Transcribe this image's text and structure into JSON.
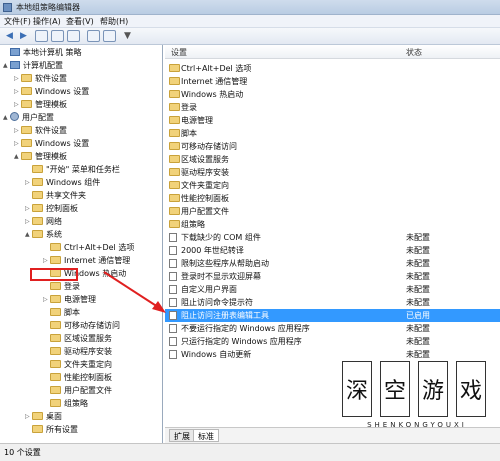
{
  "window": {
    "title": "本地组策略编辑器"
  },
  "menu": [
    "文件(F)",
    "操作(A)",
    "查看(V)",
    "帮助(H)"
  ],
  "tree": [
    {
      "label": "本地计算机 策略",
      "icon": "computer-icon",
      "expander": ""
    },
    {
      "label": "计算机配置",
      "icon": "computer-icon",
      "expander": "▲"
    },
    {
      "label": "软件设置",
      "icon": "folder-icon",
      "expander": "▷"
    },
    {
      "label": "Windows 设置",
      "icon": "folder-icon",
      "expander": "▷"
    },
    {
      "label": "管理模板",
      "icon": "folder-icon",
      "expander": "▷"
    },
    {
      "label": "用户配置",
      "icon": "user-icon",
      "expander": "▲"
    },
    {
      "label": "软件设置",
      "icon": "folder-icon",
      "expander": "▷"
    },
    {
      "label": "Windows 设置",
      "icon": "folder-icon",
      "expander": "▷"
    },
    {
      "label": "管理模板",
      "icon": "folder-icon",
      "expander": "▲"
    },
    {
      "label": "\"开始\" 菜单和任务栏",
      "icon": "folder-icon",
      "expander": ""
    },
    {
      "label": "Windows 组件",
      "icon": "folder-icon",
      "expander": "▷"
    },
    {
      "label": "共享文件夹",
      "icon": "folder-icon",
      "expander": ""
    },
    {
      "label": "控制面板",
      "icon": "folder-icon",
      "expander": "▷"
    },
    {
      "label": "网络",
      "icon": "folder-icon",
      "expander": "▷"
    },
    {
      "label": "系统",
      "icon": "folder-icon",
      "expander": "▲"
    },
    {
      "label": "Ctrl+Alt+Del 选项",
      "icon": "folder-icon",
      "expander": ""
    },
    {
      "label": "Internet 通信管理",
      "icon": "folder-icon",
      "expander": "▷"
    },
    {
      "label": "Windows 热启动",
      "icon": "folder-icon",
      "expander": ""
    },
    {
      "label": "登录",
      "icon": "folder-icon",
      "expander": ""
    },
    {
      "label": "电源管理",
      "icon": "folder-icon",
      "expander": "▷"
    },
    {
      "label": "脚本",
      "icon": "folder-icon",
      "expander": ""
    },
    {
      "label": "可移动存储访问",
      "icon": "folder-icon",
      "expander": ""
    },
    {
      "label": "区域设置服务",
      "icon": "folder-icon",
      "expander": ""
    },
    {
      "label": "驱动程序安装",
      "icon": "folder-icon",
      "expander": ""
    },
    {
      "label": "文件夹重定向",
      "icon": "folder-icon",
      "expander": ""
    },
    {
      "label": "性能控制面板",
      "icon": "folder-icon",
      "expander": ""
    },
    {
      "label": "用户配置文件",
      "icon": "folder-icon",
      "expander": ""
    },
    {
      "label": "组策略",
      "icon": "folder-icon",
      "expander": ""
    },
    {
      "label": "桌面",
      "icon": "folder-icon",
      "expander": "▷"
    },
    {
      "label": "所有设置",
      "icon": "folder-icon",
      "expander": ""
    }
  ],
  "list": {
    "col_setting": "设置",
    "col_state": "状态",
    "rows": [
      {
        "name": "Ctrl+Alt+Del 选项",
        "state": "",
        "icon": "folder-icon"
      },
      {
        "name": "Internet 通信管理",
        "state": "",
        "icon": "folder-icon"
      },
      {
        "name": "Windows 热启动",
        "state": "",
        "icon": "folder-icon"
      },
      {
        "name": "登录",
        "state": "",
        "icon": "folder-icon"
      },
      {
        "name": "电源管理",
        "state": "",
        "icon": "folder-icon"
      },
      {
        "name": "脚本",
        "state": "",
        "icon": "folder-icon"
      },
      {
        "name": "可移动存储访问",
        "state": "",
        "icon": "folder-icon"
      },
      {
        "name": "区域设置服务",
        "state": "",
        "icon": "folder-icon"
      },
      {
        "name": "驱动程序安装",
        "state": "",
        "icon": "folder-icon"
      },
      {
        "name": "文件夹重定向",
        "state": "",
        "icon": "folder-icon"
      },
      {
        "name": "性能控制面板",
        "state": "",
        "icon": "folder-icon"
      },
      {
        "name": "用户配置文件",
        "state": "",
        "icon": "folder-icon"
      },
      {
        "name": "组策略",
        "state": "",
        "icon": "folder-icon"
      },
      {
        "name": "下载缺少的 COM 组件",
        "state": "未配置",
        "icon": "policy-icon"
      },
      {
        "name": "2000 年世纪转译",
        "state": "未配置",
        "icon": "policy-icon"
      },
      {
        "name": "限制这些程序从帮助启动",
        "state": "未配置",
        "icon": "policy-icon"
      },
      {
        "name": "登录时不显示欢迎屏幕",
        "state": "未配置",
        "icon": "policy-icon"
      },
      {
        "name": "自定义用户界面",
        "state": "未配置",
        "icon": "policy-icon"
      },
      {
        "name": "阻止访问命令提示符",
        "state": "未配置",
        "icon": "policy-icon"
      },
      {
        "name": "阻止访问注册表编辑工具",
        "state": "已启用",
        "icon": "policy-icon"
      },
      {
        "name": "不要运行指定的 Windows 应用程序",
        "state": "未配置",
        "icon": "policy-icon"
      },
      {
        "name": "只运行指定的 Windows 应用程序",
        "state": "未配置",
        "icon": "policy-icon"
      },
      {
        "name": "Windows 自动更新",
        "state": "未配置",
        "icon": "policy-icon"
      }
    ]
  },
  "tabs": [
    "扩展",
    "标准"
  ],
  "status": "10 个设置",
  "watermark": {
    "chars": [
      "深",
      "空",
      "游",
      "戏"
    ],
    "sub": "SHENKONGYOUXI"
  },
  "colors": {
    "selection": "#3399ff",
    "annotation": "#e02020"
  }
}
